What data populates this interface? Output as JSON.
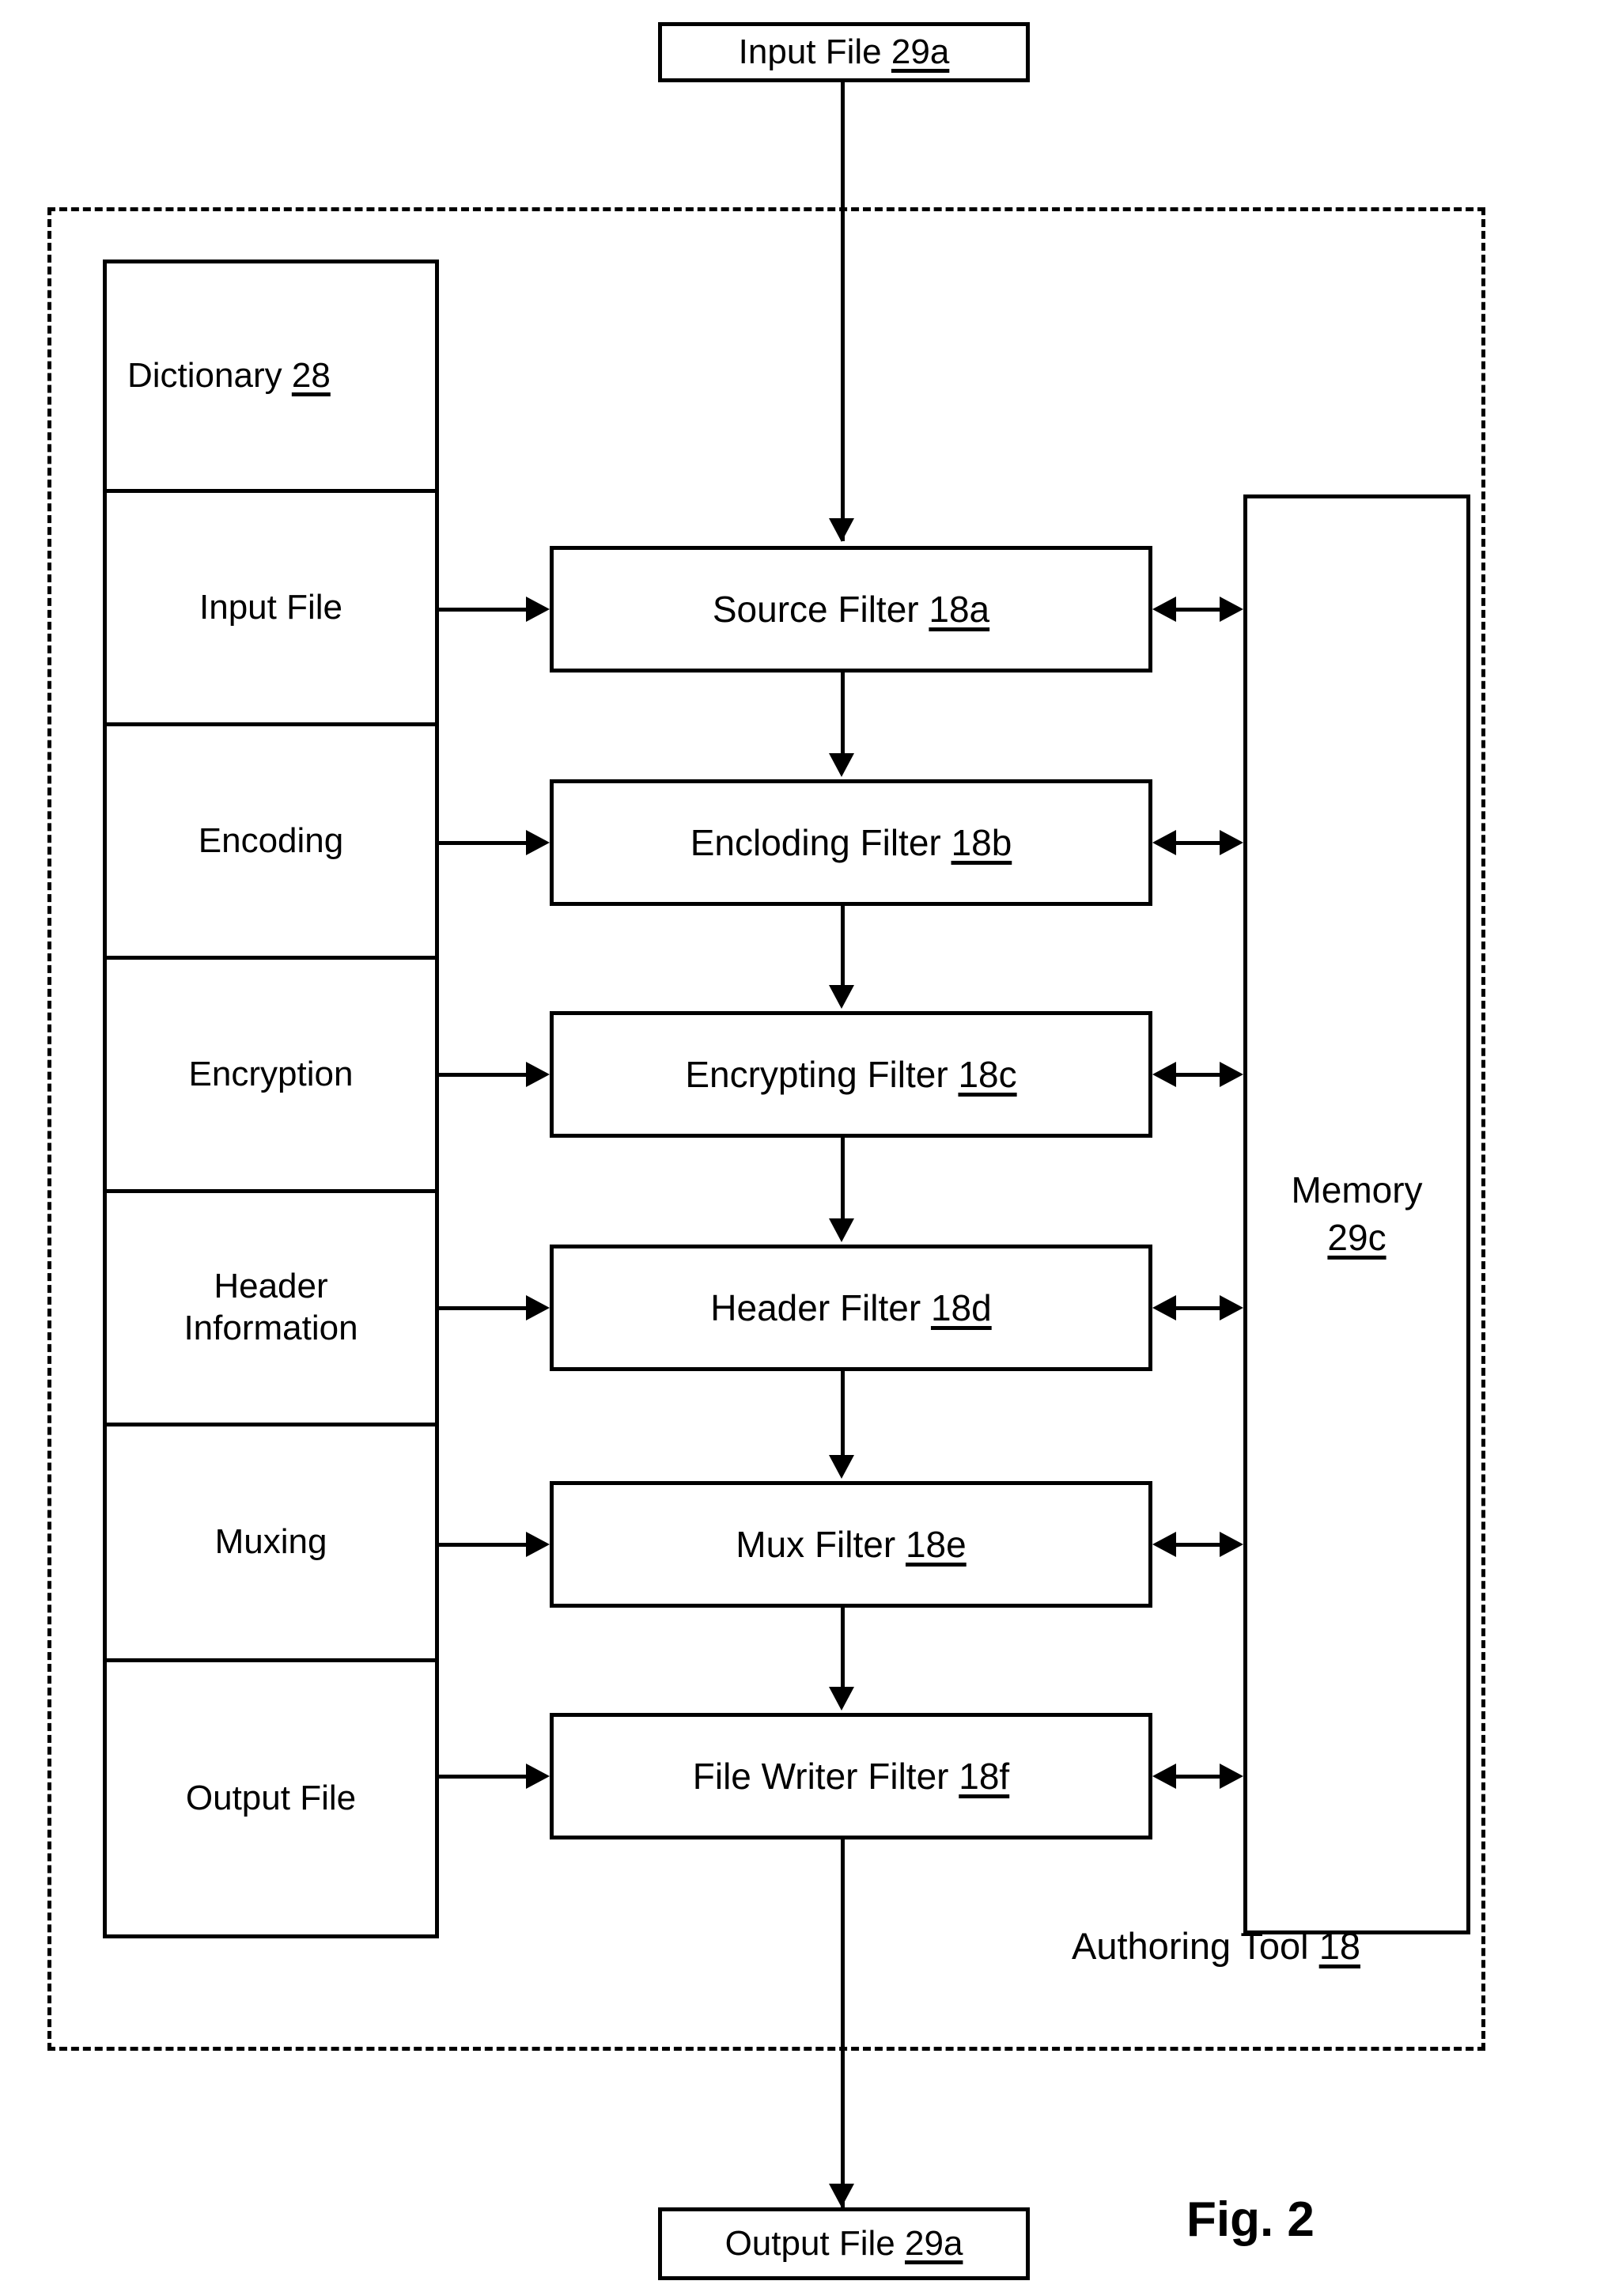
{
  "figure": {
    "caption": "Fig. 2"
  },
  "io": {
    "input": {
      "text": "Input File ",
      "ref": "29a"
    },
    "output": {
      "text": "Output File ",
      "ref": "29a"
    }
  },
  "enclosure": {
    "label_text": "Authoring Tool ",
    "label_ref": "18"
  },
  "dictionary": {
    "header_text": "Dictionary ",
    "header_ref": "28",
    "rows": [
      {
        "label": "Input File"
      },
      {
        "label": "Encoding"
      },
      {
        "label": "Encryption"
      },
      {
        "label": "Header\nInformation"
      },
      {
        "label": "Muxing"
      },
      {
        "label": "Output File"
      }
    ]
  },
  "filters": [
    {
      "name": "Source Filter ",
      "ref": "18a"
    },
    {
      "name": "Encloding Filter ",
      "ref": "18b"
    },
    {
      "name": "Encrypting Filter ",
      "ref": "18c"
    },
    {
      "name": "Header Filter ",
      "ref": "18d"
    },
    {
      "name": "Mux Filter ",
      "ref": "18e"
    },
    {
      "name": "File Writer Filter ",
      "ref": "18f"
    }
  ],
  "memory": {
    "name": "Memory",
    "ref": "29c"
  },
  "colors": {
    "stroke": "#000000",
    "background": "#ffffff"
  }
}
